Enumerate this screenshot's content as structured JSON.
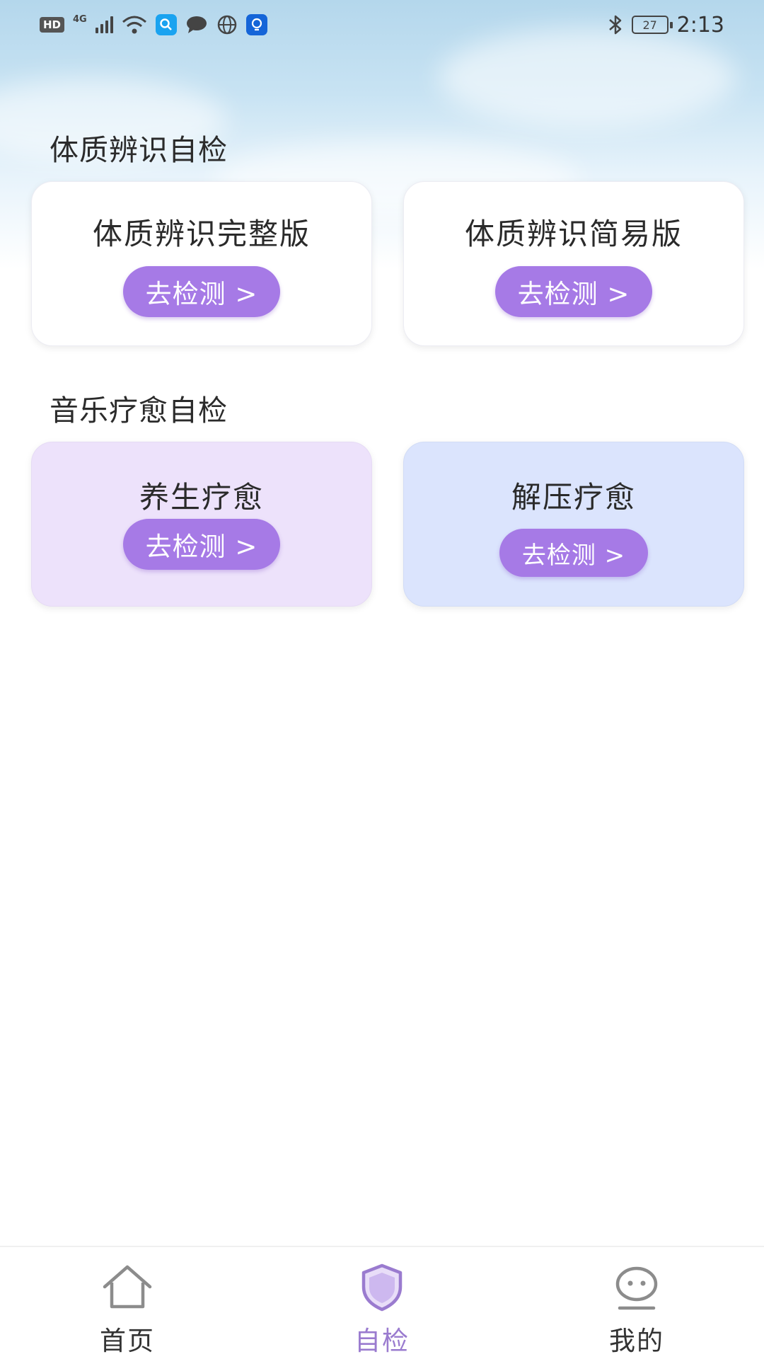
{
  "status_bar": {
    "network_badge": "HD",
    "network_type": "4G",
    "battery_level": "27",
    "time": "2:13"
  },
  "sections": [
    {
      "title": "体质辨识自检",
      "cards": [
        {
          "title": "体质辨识完整版",
          "button": "去检测 >"
        },
        {
          "title": "体质辨识简易版",
          "button": "去检测 >"
        }
      ]
    },
    {
      "title": "音乐疗愈自检",
      "cards": [
        {
          "title": "养生疗愈",
          "button": "去检测 >"
        },
        {
          "title": "解压疗愈",
          "button": "去检测 >"
        }
      ]
    }
  ],
  "bottom_nav": {
    "items": [
      {
        "label": "首页",
        "icon": "home-icon"
      },
      {
        "label": "自检",
        "icon": "shield-icon"
      },
      {
        "label": "我的",
        "icon": "face-chat-icon"
      }
    ],
    "active_index": 1
  },
  "colors": {
    "accent": "#a67ae6",
    "active_nav": "#9a7bcf",
    "card_purple": "#ede2fb",
    "card_blue": "#dbe4fd"
  }
}
